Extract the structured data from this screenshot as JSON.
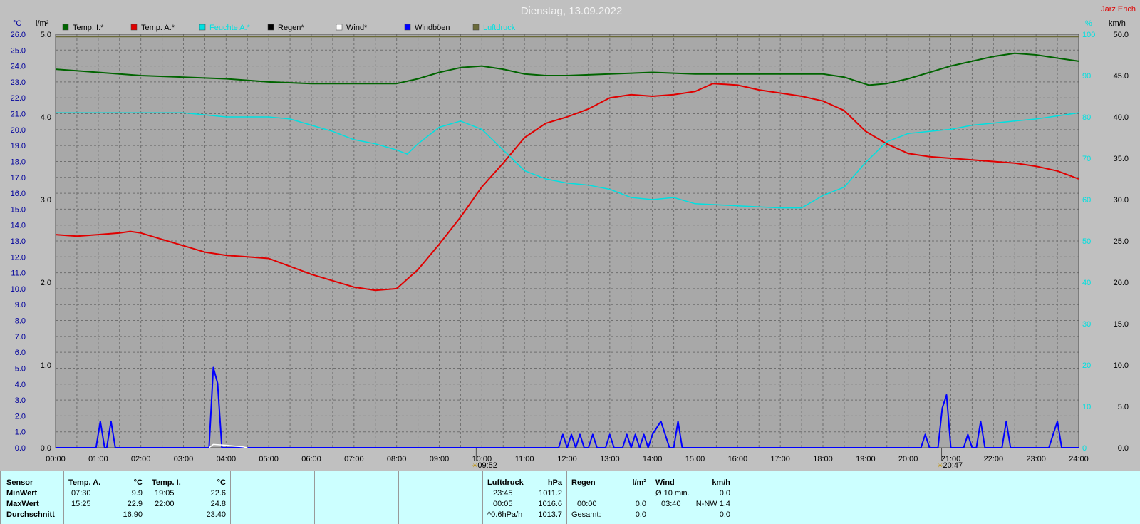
{
  "title": "Dienstag, 13.09.2022",
  "author": "Jarz Erich",
  "colors": {
    "temp_i": "#006400",
    "temp_a": "#e00000",
    "feuchte": "#00e0e0",
    "regen": "#000000",
    "wind": "#ffffff",
    "windboeen": "#0000ff",
    "luftdruck": "#6b6b3a",
    "plot_bg": "#a8a8a8"
  },
  "axes": {
    "left_unit": "°C",
    "rain_unit": "l/m²",
    "right_unit": "%",
    "wind_unit": "km/h"
  },
  "legend": [
    "Temp. I.*",
    "Temp. A.*",
    "Feuchte A.*",
    "Regen*",
    "Wind*",
    "Windböen",
    "Luftdruck"
  ],
  "markers": {
    "sunrise": "09:52",
    "sunset": "20:47"
  },
  "chart_data": {
    "type": "line",
    "title": "Dienstag, 13.09.2022",
    "x_range": [
      "00:00",
      "24:00"
    ],
    "x_ticks": [
      "00:00",
      "01:00",
      "02:00",
      "03:00",
      "04:00",
      "05:00",
      "06:00",
      "07:00",
      "08:00",
      "09:00",
      "10:00",
      "11:00",
      "12:00",
      "13:00",
      "14:00",
      "15:00",
      "16:00",
      "17:00",
      "18:00",
      "19:00",
      "20:00",
      "21:00",
      "22:00",
      "23:00",
      "24:00"
    ],
    "temp_axis": {
      "range": [
        0,
        26
      ],
      "ticks": [
        "0.0",
        "1.0",
        "2.0",
        "3.0",
        "4.0",
        "5.0",
        "6.0",
        "7.0",
        "8.0",
        "9.0",
        "10.0",
        "11.0",
        "12.0",
        "13.0",
        "14.0",
        "15.0",
        "16.0",
        "17.0",
        "18.0",
        "19.0",
        "20.0",
        "21.0",
        "22.0",
        "23.0",
        "24.0",
        "25.0",
        "26.0"
      ]
    },
    "rain_axis": {
      "range": [
        0,
        5
      ],
      "ticks": [
        "0.0",
        "1.0",
        "2.0",
        "3.0",
        "4.0",
        "5.0"
      ]
    },
    "humidity_axis": {
      "range": [
        0,
        100
      ],
      "ticks": [
        "0",
        "10",
        "20",
        "30",
        "40",
        "50",
        "60",
        "70",
        "80",
        "90",
        "100"
      ]
    },
    "wind_axis": {
      "range": [
        0,
        50
      ],
      "ticks": [
        "0.0",
        "5.0",
        "10.0",
        "15.0",
        "20.0",
        "25.0",
        "30.0",
        "35.0",
        "40.0",
        "45.0",
        "50.0"
      ]
    },
    "series": [
      {
        "name": "Temp. I.*",
        "axis": "temp",
        "points": [
          [
            0,
            23.8
          ],
          [
            1,
            23.6
          ],
          [
            2,
            23.4
          ],
          [
            3,
            23.3
          ],
          [
            4,
            23.2
          ],
          [
            5,
            23.0
          ],
          [
            6,
            22.9
          ],
          [
            7,
            22.9
          ],
          [
            8,
            22.9
          ],
          [
            8.5,
            23.2
          ],
          [
            9,
            23.6
          ],
          [
            9.5,
            23.9
          ],
          [
            10,
            24.0
          ],
          [
            10.5,
            23.8
          ],
          [
            11,
            23.5
          ],
          [
            11.5,
            23.4
          ],
          [
            12,
            23.4
          ],
          [
            13,
            23.5
          ],
          [
            14,
            23.6
          ],
          [
            15,
            23.5
          ],
          [
            16,
            23.5
          ],
          [
            17,
            23.5
          ],
          [
            18,
            23.5
          ],
          [
            18.5,
            23.3
          ],
          [
            19.08,
            22.8
          ],
          [
            19.5,
            22.9
          ],
          [
            20,
            23.2
          ],
          [
            20.5,
            23.6
          ],
          [
            21,
            24.0
          ],
          [
            21.5,
            24.3
          ],
          [
            22,
            24.6
          ],
          [
            22.5,
            24.8
          ],
          [
            23,
            24.7
          ],
          [
            23.5,
            24.5
          ],
          [
            24,
            24.3
          ]
        ]
      },
      {
        "name": "Temp. A.*",
        "axis": "temp",
        "points": [
          [
            0,
            13.4
          ],
          [
            0.5,
            13.3
          ],
          [
            1,
            13.4
          ],
          [
            1.5,
            13.5
          ],
          [
            1.75,
            13.6
          ],
          [
            2,
            13.5
          ],
          [
            2.5,
            13.1
          ],
          [
            3,
            12.7
          ],
          [
            3.5,
            12.3
          ],
          [
            4,
            12.1
          ],
          [
            4.5,
            12.0
          ],
          [
            5,
            11.9
          ],
          [
            5.5,
            11.4
          ],
          [
            6,
            10.9
          ],
          [
            6.5,
            10.5
          ],
          [
            7,
            10.1
          ],
          [
            7.5,
            9.9
          ],
          [
            8,
            10.0
          ],
          [
            8.5,
            11.2
          ],
          [
            9,
            12.8
          ],
          [
            9.5,
            14.5
          ],
          [
            10,
            16.4
          ],
          [
            10.5,
            17.9
          ],
          [
            11,
            19.5
          ],
          [
            11.5,
            20.4
          ],
          [
            12,
            20.8
          ],
          [
            12.5,
            21.3
          ],
          [
            13,
            22.0
          ],
          [
            13.5,
            22.2
          ],
          [
            14,
            22.1
          ],
          [
            14.5,
            22.2
          ],
          [
            15,
            22.4
          ],
          [
            15.42,
            22.9
          ],
          [
            16,
            22.8
          ],
          [
            16.5,
            22.5
          ],
          [
            17,
            22.3
          ],
          [
            17.5,
            22.1
          ],
          [
            18,
            21.8
          ],
          [
            18.5,
            21.2
          ],
          [
            19,
            19.9
          ],
          [
            19.5,
            19.1
          ],
          [
            20,
            18.5
          ],
          [
            20.5,
            18.3
          ],
          [
            21,
            18.2
          ],
          [
            21.5,
            18.1
          ],
          [
            22,
            18.0
          ],
          [
            22.5,
            17.9
          ],
          [
            23,
            17.7
          ],
          [
            23.5,
            17.4
          ],
          [
            24,
            16.9
          ]
        ]
      },
      {
        "name": "Feuchte A.*",
        "axis": "humidity",
        "points": [
          [
            0,
            81
          ],
          [
            1,
            81
          ],
          [
            2,
            81
          ],
          [
            3,
            81
          ],
          [
            4,
            80
          ],
          [
            5,
            80
          ],
          [
            5.5,
            79.5
          ],
          [
            6,
            78
          ],
          [
            6.5,
            76.5
          ],
          [
            7,
            74.5
          ],
          [
            7.5,
            73.5
          ],
          [
            8,
            72
          ],
          [
            8.25,
            71
          ],
          [
            8.5,
            73.5
          ],
          [
            9,
            77.5
          ],
          [
            9.5,
            79
          ],
          [
            10,
            77
          ],
          [
            10.5,
            72
          ],
          [
            11,
            67
          ],
          [
            11.5,
            65
          ],
          [
            12,
            64
          ],
          [
            12.5,
            63.5
          ],
          [
            13,
            62.5
          ],
          [
            13.5,
            60.5
          ],
          [
            14,
            60
          ],
          [
            14.5,
            60.5
          ],
          [
            15,
            59
          ],
          [
            16,
            58.5
          ],
          [
            17,
            58
          ],
          [
            17.5,
            58
          ],
          [
            18,
            61
          ],
          [
            18.5,
            63
          ],
          [
            19,
            69
          ],
          [
            19.5,
            74
          ],
          [
            20,
            76
          ],
          [
            20.5,
            76.5
          ],
          [
            21,
            77
          ],
          [
            21.5,
            78
          ],
          [
            22,
            78.5
          ],
          [
            22.5,
            79
          ],
          [
            23,
            79.5
          ],
          [
            24,
            81
          ]
        ]
      },
      {
        "name": "Luftdruck",
        "axis": "rain",
        "points": [
          [
            0,
            4.97
          ],
          [
            1,
            4.97
          ],
          [
            2,
            4.97
          ],
          [
            3,
            4.97
          ],
          [
            4,
            4.97
          ],
          [
            5,
            4.97
          ],
          [
            6,
            4.97
          ],
          [
            7,
            4.97
          ],
          [
            8,
            4.97
          ],
          [
            9,
            4.97
          ],
          [
            10,
            4.97
          ],
          [
            11,
            4.97
          ],
          [
            12,
            4.97
          ],
          [
            13,
            4.97
          ],
          [
            14,
            4.97
          ],
          [
            15,
            4.97
          ],
          [
            16,
            4.97
          ],
          [
            17,
            4.97
          ],
          [
            18,
            4.97
          ],
          [
            19,
            4.97
          ],
          [
            20,
            4.97
          ],
          [
            21,
            4.97
          ],
          [
            22,
            4.97
          ],
          [
            23,
            4.97
          ],
          [
            24,
            4.97
          ]
        ]
      },
      {
        "name": "Windböen",
        "axis": "wind",
        "points": [
          [
            0,
            0
          ],
          [
            0.95,
            0
          ],
          [
            1.05,
            3.2
          ],
          [
            1.15,
            0
          ],
          [
            1.2,
            0
          ],
          [
            1.3,
            3.2
          ],
          [
            1.4,
            0
          ],
          [
            3.6,
            0
          ],
          [
            3.7,
            9.7
          ],
          [
            3.8,
            7.8
          ],
          [
            3.9,
            0
          ],
          [
            11.8,
            0
          ],
          [
            11.9,
            1.6
          ],
          [
            12.0,
            0
          ],
          [
            12.1,
            1.6
          ],
          [
            12.2,
            0
          ],
          [
            12.3,
            1.6
          ],
          [
            12.4,
            0
          ],
          [
            12.5,
            0
          ],
          [
            12.6,
            1.6
          ],
          [
            12.7,
            0
          ],
          [
            12.9,
            0
          ],
          [
            13.0,
            1.6
          ],
          [
            13.1,
            0
          ],
          [
            13.3,
            0
          ],
          [
            13.4,
            1.6
          ],
          [
            13.5,
            0
          ],
          [
            13.6,
            1.6
          ],
          [
            13.7,
            0
          ],
          [
            13.8,
            1.6
          ],
          [
            13.9,
            0
          ],
          [
            14.0,
            1.6
          ],
          [
            14.2,
            3.2
          ],
          [
            14.4,
            0
          ],
          [
            14.5,
            0
          ],
          [
            14.6,
            3.2
          ],
          [
            14.7,
            0
          ],
          [
            20.3,
            0
          ],
          [
            20.4,
            1.6
          ],
          [
            20.5,
            0
          ],
          [
            20.7,
            0
          ],
          [
            20.8,
            4.8
          ],
          [
            20.9,
            6.4
          ],
          [
            21.0,
            0
          ],
          [
            21.3,
            0
          ],
          [
            21.4,
            1.6
          ],
          [
            21.5,
            0
          ],
          [
            21.6,
            0
          ],
          [
            21.7,
            3.2
          ],
          [
            21.8,
            0
          ],
          [
            22.2,
            0
          ],
          [
            22.3,
            3.2
          ],
          [
            22.4,
            0
          ],
          [
            23.3,
            0
          ],
          [
            23.5,
            3.2
          ],
          [
            23.6,
            0
          ],
          [
            24,
            0
          ]
        ]
      },
      {
        "name": "Wind*",
        "axis": "wind",
        "points": [
          [
            3.6,
            0
          ],
          [
            3.7,
            0.4
          ],
          [
            4.0,
            0.3
          ],
          [
            4.4,
            0.1
          ],
          [
            4.5,
            0
          ]
        ]
      }
    ]
  },
  "stats": {
    "sensor": {
      "header": "Sensor",
      "rows": [
        "MinWert",
        "MaxWert",
        "Durchschnitt"
      ]
    },
    "temp_a": {
      "header": "Temp. A.",
      "unit": "°C",
      "min_time": "07:30",
      "min_val": "9.9",
      "max_time": "15:25",
      "max_val": "22.9",
      "avg": "16.90"
    },
    "temp_i": {
      "header": "Temp. I.",
      "unit": "°C",
      "min_time": "19:05",
      "min_val": "22.6",
      "max_time": "22:00",
      "max_val": "24.8",
      "avg": "23.40"
    },
    "luftdruck": {
      "header": "Luftdruck",
      "unit": "hPa",
      "min_time": "23:45",
      "min_val": "1011.2",
      "max_time": "00:05",
      "max_val": "1016.6",
      "trend_label": "^0.6hPa/h",
      "trend_val": "1013.7"
    },
    "regen": {
      "header": "Regen",
      "unit": "l/m²",
      "max_time": "00:00",
      "max_val": "0.0",
      "total_label": "Gesamt:",
      "total_val": "0.0"
    },
    "wind": {
      "header": "Wind",
      "unit": "km/h",
      "avg_label": "Ø 10 min.",
      "avg_val": "0.0",
      "max_time": "03:40",
      "max_dir": "N-NW 1.4",
      "last_val": "0.0"
    }
  }
}
